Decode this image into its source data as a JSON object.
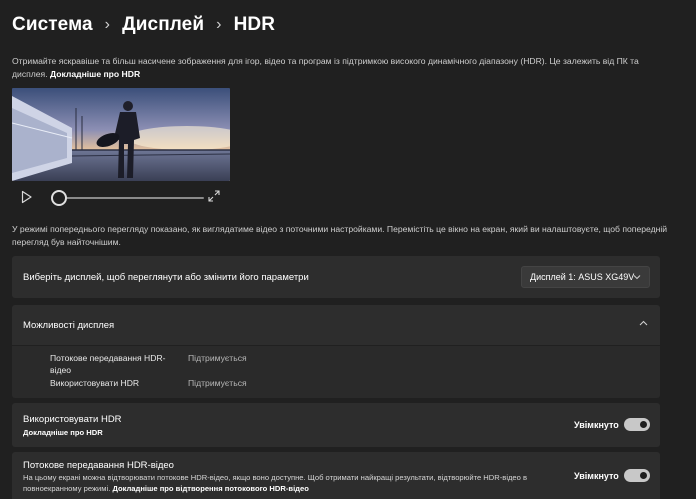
{
  "breadcrumb": {
    "part1": "Система",
    "part2": "Дисплей",
    "part3": "HDR",
    "separator": "›"
  },
  "description": {
    "text": "Отримайте яскравіше та більш насичене зображення для ігор, відео та програм із підтримкою високого динамічного діапазону (HDR). Це залежить від ПК та дисплея.",
    "link": "Докладніше про HDR"
  },
  "video_player": {
    "play_icon": "play-icon",
    "expand_icon": "expand-icon",
    "progress": 0.0
  },
  "preview_note": "У режимі попереднього перегляду показано, як виглядатиме відео з поточними настройками. Перемістіть це вікно на екран, який ви налаштовуєте, щоб попередній перегляд був найточнішим.",
  "display_select": {
    "label": "Виберіть дисплей, щоб переглянути або змінити його параметри",
    "value": "Дисплей 1: ASUS XG49V"
  },
  "capabilities": {
    "title": "Можливості дисплея",
    "items": [
      {
        "name": "Потокове передавання HDR-відео",
        "value": "Підтримується"
      },
      {
        "name": "Використовувати HDR",
        "value": "Підтримується"
      }
    ]
  },
  "use_hdr": {
    "label": "Використовувати HDR",
    "link": "Докладніше про HDR",
    "state_label": "Увімкнуто",
    "on": true
  },
  "hdr_streaming": {
    "label": "Потокове передавання HDR-відео",
    "description": "На цьому екрані можна відтворювати потокове HDR-відео, якщо воно доступне. Щоб отримати найкращі результати, відтворюйте HDR-відео в повноекранному режимі.",
    "link": "Докладніше про відтворення потокового HDR-відео",
    "state_label": "Увімкнуто",
    "on": true
  },
  "colors": {
    "background": "#202020",
    "card": "#2d2d2d",
    "toggle_on": "#c8c8c8"
  }
}
